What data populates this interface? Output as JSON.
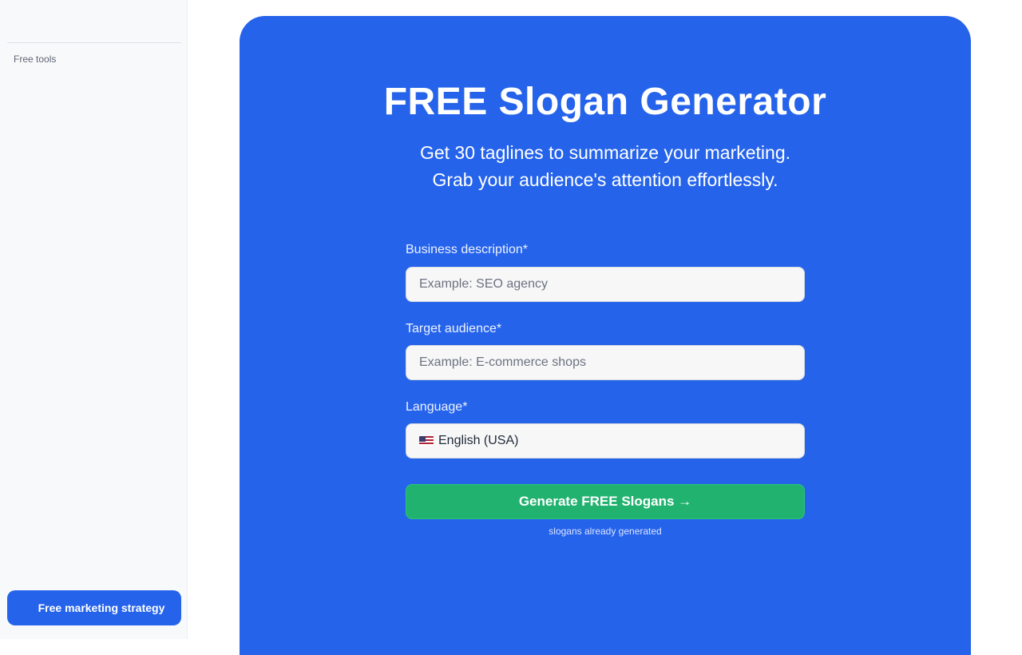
{
  "sidebar": {
    "section_label": "Free tools",
    "cta_label": "Free marketing strategy"
  },
  "hero": {
    "title": "FREE Slogan Generator",
    "subtitle_line1": "Get 30 taglines to summarize your marketing.",
    "subtitle_line2": "Grab your audience's attention effortlessly."
  },
  "form": {
    "business": {
      "label": "Business description*",
      "placeholder": "Example: SEO agency",
      "value": ""
    },
    "audience": {
      "label": "Target audience*",
      "placeholder": "Example: E-commerce shops",
      "value": ""
    },
    "language": {
      "label": "Language*",
      "flag_icon": "us-flag-icon",
      "selected": "English (USA)"
    },
    "submit_label": "Generate FREE Slogans →",
    "counter_text": "slogans already generated"
  },
  "colors": {
    "brand": "#2563eb",
    "cta_green": "#21b26f"
  }
}
